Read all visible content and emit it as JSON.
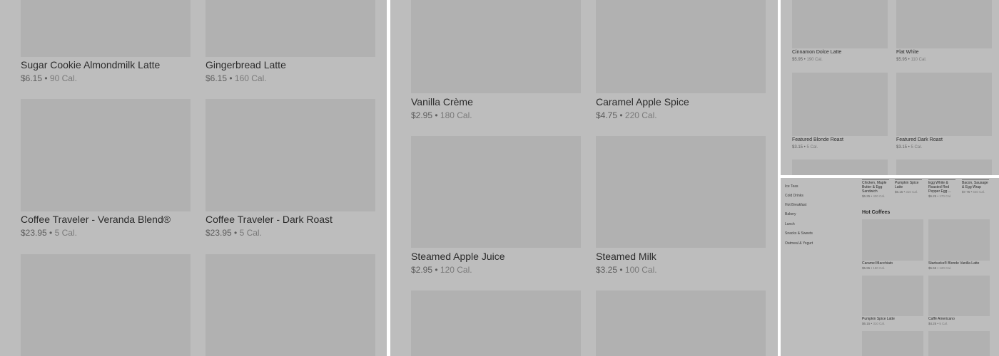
{
  "panel_a": {
    "items": [
      {
        "name": "Sugar Cookie Almondmilk Latte",
        "price": "$6.15",
        "calories": "90 Cal."
      },
      {
        "name": "Gingerbread Latte",
        "price": "$6.15",
        "calories": "160 Cal."
      },
      {
        "name": "Coffee Traveler - Veranda Blend®",
        "price": "$23.95",
        "calories": "5 Cal."
      },
      {
        "name": "Coffee Traveler - Dark Roast",
        "price": "$23.95",
        "calories": "5 Cal."
      }
    ]
  },
  "panel_b": {
    "items": [
      {
        "name": "Vanilla Crème",
        "price": "$2.95",
        "calories": "180 Cal."
      },
      {
        "name": "Caramel Apple Spice",
        "price": "$4.75",
        "calories": "220 Cal."
      },
      {
        "name": "Steamed Apple Juice",
        "price": "$2.95",
        "calories": "120 Cal."
      },
      {
        "name": "Steamed Milk",
        "price": "$3.25",
        "calories": "100 Cal."
      }
    ]
  },
  "panel_c": {
    "items": [
      {
        "name": "Cinnamon Dolce Latte",
        "price": "$5.95",
        "calories": "190 Cal."
      },
      {
        "name": "Flat White",
        "price": "$5.95",
        "calories": "110 Cal."
      },
      {
        "name": "Featured Blonde Roast",
        "price": "$3.15",
        "calories": "5 Cal."
      },
      {
        "name": "Featured Dark Roast",
        "price": "$3.15",
        "calories": "5 Cal."
      }
    ]
  },
  "panel_d": {
    "sidebar": [
      "Ice Teas",
      "Cold Drinks",
      "Hot Breakfast",
      "Bakery",
      "Lunch",
      "Snacks & Sweets",
      "Oatmeal & Yogurt"
    ],
    "top_items": [
      {
        "name": "Chicken, Maple Butter & Egg Sandwich",
        "price": "$6.25",
        "calories": "400 Cal."
      },
      {
        "name": "Pumpkin Spice Latte",
        "price": "$6.15",
        "calories": "310 Cal."
      },
      {
        "name": "Egg White & Roasted Red Pepper Egg ...",
        "price": "$6.25",
        "calories": "170 Cal."
      },
      {
        "name": "Bacon, Sausage & Egg Wrap",
        "price": "$7.75",
        "calories": "640 Cal."
      }
    ],
    "section_title": "Hot Coffees",
    "items": [
      {
        "name": "Caramel Macchiato",
        "price": "$5.95",
        "calories": "180 Cal."
      },
      {
        "name": "Starbucks® Blonde Vanilla Latte",
        "price": "$5.55",
        "calories": "120 Cal."
      },
      {
        "name": "Pumpkin Spice Latte",
        "price": "$6.15",
        "calories": "310 Cal."
      },
      {
        "name": "Caffè Americano",
        "price": "$4.25",
        "calories": "5 Cal."
      }
    ]
  },
  "colors": {
    "panel_bg": "#bdbdbd",
    "thumb_bg": "#b1b1b1",
    "text": "#2b2b2b"
  }
}
